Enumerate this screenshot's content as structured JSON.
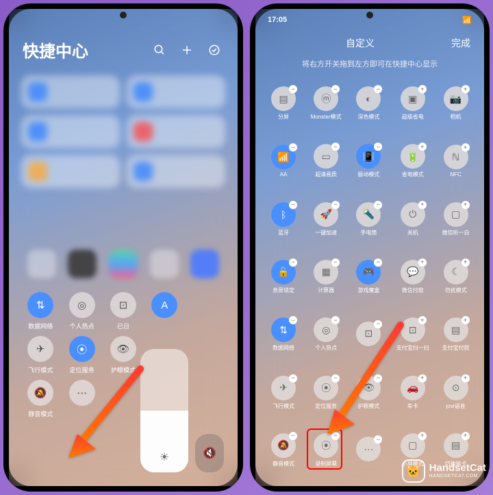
{
  "phone1": {
    "header": {
      "title": "快捷中心"
    },
    "quick": [
      {
        "label": "数据网络",
        "glyph": "⇅",
        "active": true
      },
      {
        "label": "个人热点",
        "glyph": "◎",
        "active": false
      },
      {
        "label": "已日",
        "glyph": "⊡",
        "active": false
      },
      {
        "label": "",
        "glyph": "A",
        "active": true
      },
      {
        "label": "",
        "glyph": "",
        "active": false
      },
      {
        "label": "飞行模式",
        "glyph": "✈",
        "active": false
      },
      {
        "label": "定位服务",
        "glyph": "⦿",
        "active": true
      },
      {
        "label": "护眼模式",
        "glyph": "👁",
        "active": false
      },
      {
        "label": "",
        "glyph": "",
        "active": false
      },
      {
        "label": "",
        "glyph": "",
        "active": false
      },
      {
        "label": "静音模式",
        "glyph": "🔕",
        "active": false
      },
      {
        "label": "",
        "glyph": "⋯",
        "active": false
      }
    ]
  },
  "phone2": {
    "status": {
      "time": "17:05"
    },
    "header": {
      "title": "自定义",
      "done": "完成"
    },
    "hint": "将右方开关拖到左方即可在快捷中心显示",
    "left": [
      {
        "label": "分屏",
        "glyph": "▤",
        "active": false
      },
      {
        "label": "Monster模式",
        "glyph": "ⓜ",
        "active": false
      },
      {
        "label": "深色模式",
        "glyph": "◐",
        "active": false
      },
      {
        "label": "AA",
        "glyph": "📶",
        "active": true
      },
      {
        "label": "超清画质",
        "glyph": "▭",
        "active": false
      },
      {
        "label": "振动模式",
        "glyph": "📳",
        "active": true
      },
      {
        "label": "蓝牙",
        "glyph": "ᛒ",
        "active": true
      },
      {
        "label": "一键加速",
        "glyph": "🚀",
        "active": false
      },
      {
        "label": "手电筒",
        "glyph": "🔦",
        "active": false
      },
      {
        "label": "息屏锁定",
        "glyph": "🔒",
        "active": true
      },
      {
        "label": "计算器",
        "glyph": "▦",
        "active": false
      },
      {
        "label": "游戏魔盒",
        "glyph": "🎮",
        "active": true
      },
      {
        "label": "数据网络",
        "glyph": "⇅",
        "active": true
      },
      {
        "label": "个人热点",
        "glyph": "◎",
        "active": false
      },
      {
        "label": "",
        "glyph": "⊡",
        "active": false
      },
      {
        "label": "飞行模式",
        "glyph": "✈",
        "active": false
      },
      {
        "label": "定位服务",
        "glyph": "⦿",
        "active": false
      },
      {
        "label": "护眼模式",
        "glyph": "👁",
        "active": false
      },
      {
        "label": "静音模式",
        "glyph": "🔕",
        "active": false
      },
      {
        "label": "录制屏幕",
        "glyph": "⦿",
        "active": false
      },
      {
        "label": "",
        "glyph": "⋯",
        "active": false
      }
    ],
    "right": [
      {
        "label": "超级省电",
        "glyph": "▣",
        "active": false
      },
      {
        "label": "相机",
        "glyph": "📷",
        "active": false
      },
      {
        "label": "省电模式",
        "glyph": "🔋",
        "active": false
      },
      {
        "label": "NFC",
        "glyph": "ℕ",
        "active": false
      },
      {
        "label": "关机",
        "glyph": "⏻",
        "active": false
      },
      {
        "label": "微信听一白",
        "glyph": "▢",
        "active": false
      },
      {
        "label": "微信付款",
        "glyph": "💬",
        "active": false
      },
      {
        "label": "勿扰模式",
        "glyph": "☾",
        "active": false
      },
      {
        "label": "支付宝扫一扫",
        "glyph": "⊡",
        "active": false
      },
      {
        "label": "支付宝付款",
        "glyph": "▤",
        "active": false
      },
      {
        "label": "车卡",
        "glyph": "🚗",
        "active": false
      },
      {
        "label": "jovi语音",
        "glyph": "⊙",
        "active": false
      },
      {
        "label": "小屏模式",
        "glyph": "▢",
        "active": false
      },
      {
        "label": "切换输卡",
        "glyph": "▤",
        "active": false
      }
    ]
  },
  "watermark": {
    "title": "HandsetCat",
    "sub": "HANDSETCAT.COM",
    "glyph": "🐱"
  }
}
